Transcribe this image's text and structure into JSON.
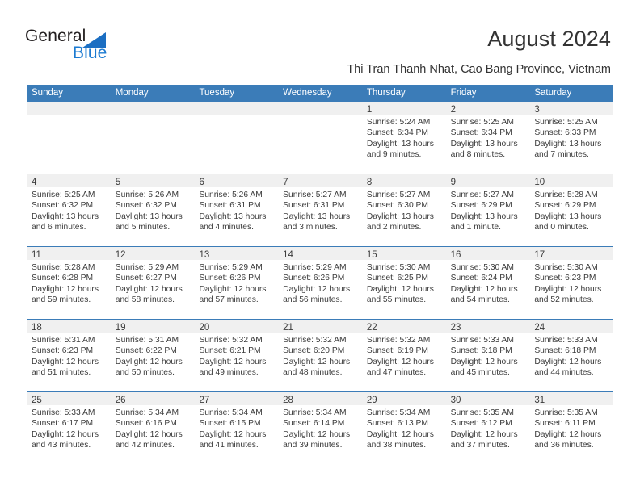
{
  "logo": {
    "word1": "General",
    "word2": "Blue",
    "triangle_color": "#1b6ec2",
    "word2_color": "#1b7ad1"
  },
  "header": {
    "title": "August 2024",
    "subtitle": "Thi Tran Thanh Nhat, Cao Bang Province, Vietnam",
    "accent_color": "#3b7cb8",
    "band_color": "#f0f0f0"
  },
  "calendar": {
    "weekday_headers": [
      "Sunday",
      "Monday",
      "Tuesday",
      "Wednesday",
      "Thursday",
      "Friday",
      "Saturday"
    ],
    "weeks": [
      [
        {
          "day": "",
          "sunrise": "",
          "sunset": "",
          "daylight": ""
        },
        {
          "day": "",
          "sunrise": "",
          "sunset": "",
          "daylight": ""
        },
        {
          "day": "",
          "sunrise": "",
          "sunset": "",
          "daylight": ""
        },
        {
          "day": "",
          "sunrise": "",
          "sunset": "",
          "daylight": ""
        },
        {
          "day": "1",
          "sunrise": "Sunrise: 5:24 AM",
          "sunset": "Sunset: 6:34 PM",
          "daylight": "Daylight: 13 hours and 9 minutes."
        },
        {
          "day": "2",
          "sunrise": "Sunrise: 5:25 AM",
          "sunset": "Sunset: 6:34 PM",
          "daylight": "Daylight: 13 hours and 8 minutes."
        },
        {
          "day": "3",
          "sunrise": "Sunrise: 5:25 AM",
          "sunset": "Sunset: 6:33 PM",
          "daylight": "Daylight: 13 hours and 7 minutes."
        }
      ],
      [
        {
          "day": "4",
          "sunrise": "Sunrise: 5:25 AM",
          "sunset": "Sunset: 6:32 PM",
          "daylight": "Daylight: 13 hours and 6 minutes."
        },
        {
          "day": "5",
          "sunrise": "Sunrise: 5:26 AM",
          "sunset": "Sunset: 6:32 PM",
          "daylight": "Daylight: 13 hours and 5 minutes."
        },
        {
          "day": "6",
          "sunrise": "Sunrise: 5:26 AM",
          "sunset": "Sunset: 6:31 PM",
          "daylight": "Daylight: 13 hours and 4 minutes."
        },
        {
          "day": "7",
          "sunrise": "Sunrise: 5:27 AM",
          "sunset": "Sunset: 6:31 PM",
          "daylight": "Daylight: 13 hours and 3 minutes."
        },
        {
          "day": "8",
          "sunrise": "Sunrise: 5:27 AM",
          "sunset": "Sunset: 6:30 PM",
          "daylight": "Daylight: 13 hours and 2 minutes."
        },
        {
          "day": "9",
          "sunrise": "Sunrise: 5:27 AM",
          "sunset": "Sunset: 6:29 PM",
          "daylight": "Daylight: 13 hours and 1 minute."
        },
        {
          "day": "10",
          "sunrise": "Sunrise: 5:28 AM",
          "sunset": "Sunset: 6:29 PM",
          "daylight": "Daylight: 13 hours and 0 minutes."
        }
      ],
      [
        {
          "day": "11",
          "sunrise": "Sunrise: 5:28 AM",
          "sunset": "Sunset: 6:28 PM",
          "daylight": "Daylight: 12 hours and 59 minutes."
        },
        {
          "day": "12",
          "sunrise": "Sunrise: 5:29 AM",
          "sunset": "Sunset: 6:27 PM",
          "daylight": "Daylight: 12 hours and 58 minutes."
        },
        {
          "day": "13",
          "sunrise": "Sunrise: 5:29 AM",
          "sunset": "Sunset: 6:26 PM",
          "daylight": "Daylight: 12 hours and 57 minutes."
        },
        {
          "day": "14",
          "sunrise": "Sunrise: 5:29 AM",
          "sunset": "Sunset: 6:26 PM",
          "daylight": "Daylight: 12 hours and 56 minutes."
        },
        {
          "day": "15",
          "sunrise": "Sunrise: 5:30 AM",
          "sunset": "Sunset: 6:25 PM",
          "daylight": "Daylight: 12 hours and 55 minutes."
        },
        {
          "day": "16",
          "sunrise": "Sunrise: 5:30 AM",
          "sunset": "Sunset: 6:24 PM",
          "daylight": "Daylight: 12 hours and 54 minutes."
        },
        {
          "day": "17",
          "sunrise": "Sunrise: 5:30 AM",
          "sunset": "Sunset: 6:23 PM",
          "daylight": "Daylight: 12 hours and 52 minutes."
        }
      ],
      [
        {
          "day": "18",
          "sunrise": "Sunrise: 5:31 AM",
          "sunset": "Sunset: 6:23 PM",
          "daylight": "Daylight: 12 hours and 51 minutes."
        },
        {
          "day": "19",
          "sunrise": "Sunrise: 5:31 AM",
          "sunset": "Sunset: 6:22 PM",
          "daylight": "Daylight: 12 hours and 50 minutes."
        },
        {
          "day": "20",
          "sunrise": "Sunrise: 5:32 AM",
          "sunset": "Sunset: 6:21 PM",
          "daylight": "Daylight: 12 hours and 49 minutes."
        },
        {
          "day": "21",
          "sunrise": "Sunrise: 5:32 AM",
          "sunset": "Sunset: 6:20 PM",
          "daylight": "Daylight: 12 hours and 48 minutes."
        },
        {
          "day": "22",
          "sunrise": "Sunrise: 5:32 AM",
          "sunset": "Sunset: 6:19 PM",
          "daylight": "Daylight: 12 hours and 47 minutes."
        },
        {
          "day": "23",
          "sunrise": "Sunrise: 5:33 AM",
          "sunset": "Sunset: 6:18 PM",
          "daylight": "Daylight: 12 hours and 45 minutes."
        },
        {
          "day": "24",
          "sunrise": "Sunrise: 5:33 AM",
          "sunset": "Sunset: 6:18 PM",
          "daylight": "Daylight: 12 hours and 44 minutes."
        }
      ],
      [
        {
          "day": "25",
          "sunrise": "Sunrise: 5:33 AM",
          "sunset": "Sunset: 6:17 PM",
          "daylight": "Daylight: 12 hours and 43 minutes."
        },
        {
          "day": "26",
          "sunrise": "Sunrise: 5:34 AM",
          "sunset": "Sunset: 6:16 PM",
          "daylight": "Daylight: 12 hours and 42 minutes."
        },
        {
          "day": "27",
          "sunrise": "Sunrise: 5:34 AM",
          "sunset": "Sunset: 6:15 PM",
          "daylight": "Daylight: 12 hours and 41 minutes."
        },
        {
          "day": "28",
          "sunrise": "Sunrise: 5:34 AM",
          "sunset": "Sunset: 6:14 PM",
          "daylight": "Daylight: 12 hours and 39 minutes."
        },
        {
          "day": "29",
          "sunrise": "Sunrise: 5:34 AM",
          "sunset": "Sunset: 6:13 PM",
          "daylight": "Daylight: 12 hours and 38 minutes."
        },
        {
          "day": "30",
          "sunrise": "Sunrise: 5:35 AM",
          "sunset": "Sunset: 6:12 PM",
          "daylight": "Daylight: 12 hours and 37 minutes."
        },
        {
          "day": "31",
          "sunrise": "Sunrise: 5:35 AM",
          "sunset": "Sunset: 6:11 PM",
          "daylight": "Daylight: 12 hours and 36 minutes."
        }
      ]
    ]
  }
}
